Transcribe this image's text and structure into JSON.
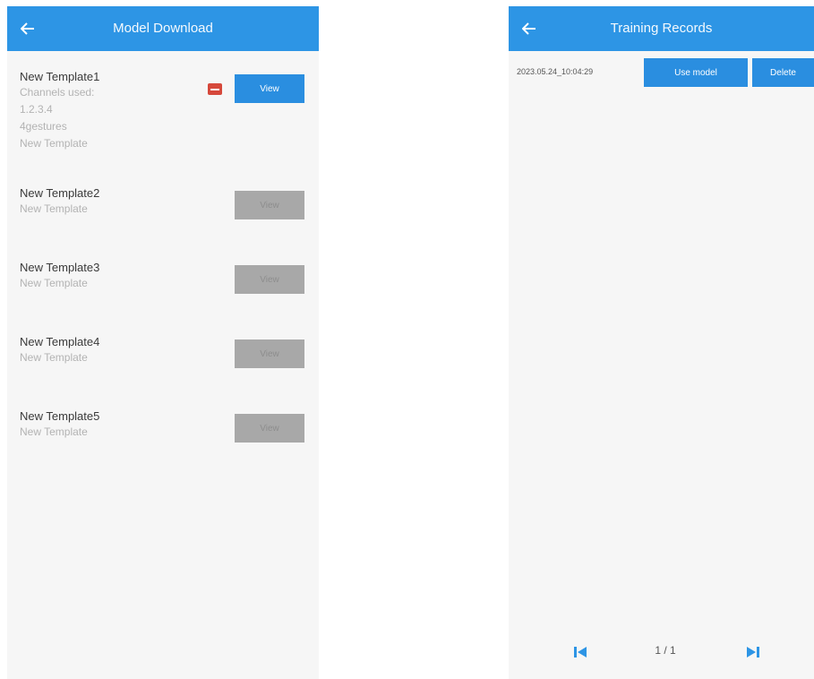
{
  "left_screen": {
    "title": "Model Download",
    "back_icon": "arrow-left-icon",
    "templates": [
      {
        "name": "New Template1",
        "details": [
          "Channels used:",
          "1.2.3.4",
          "4gestures",
          "New Template"
        ],
        "button": "View",
        "enabled": true,
        "has_delete": true
      },
      {
        "name": "New Template2",
        "details": [
          "New Template"
        ],
        "button": "View",
        "enabled": false,
        "has_delete": false
      },
      {
        "name": "New Template3",
        "details": [
          "New Template"
        ],
        "button": "View",
        "enabled": false,
        "has_delete": false
      },
      {
        "name": "New Template4",
        "details": [
          "New Template"
        ],
        "button": "View",
        "enabled": false,
        "has_delete": false
      },
      {
        "name": "New Template5",
        "details": [
          "New Template"
        ],
        "button": "View",
        "enabled": false,
        "has_delete": false
      }
    ]
  },
  "right_screen": {
    "title": "Training Records",
    "back_icon": "arrow-left-icon",
    "record": {
      "date": "2023.05.24_10:04:29",
      "use_model_label": "Use model",
      "delete_label": "Delete"
    },
    "pager": {
      "page": "1 / 1",
      "first_icon": "skip-to-first-icon",
      "last_icon": "skip-to-last-icon"
    }
  },
  "colors": {
    "appbar": "#2d95e5",
    "button_blue": "#2a8ee0",
    "button_gray": "#a8a8a8",
    "delete_red": "#d6483b",
    "background": "#f6f6f6"
  }
}
